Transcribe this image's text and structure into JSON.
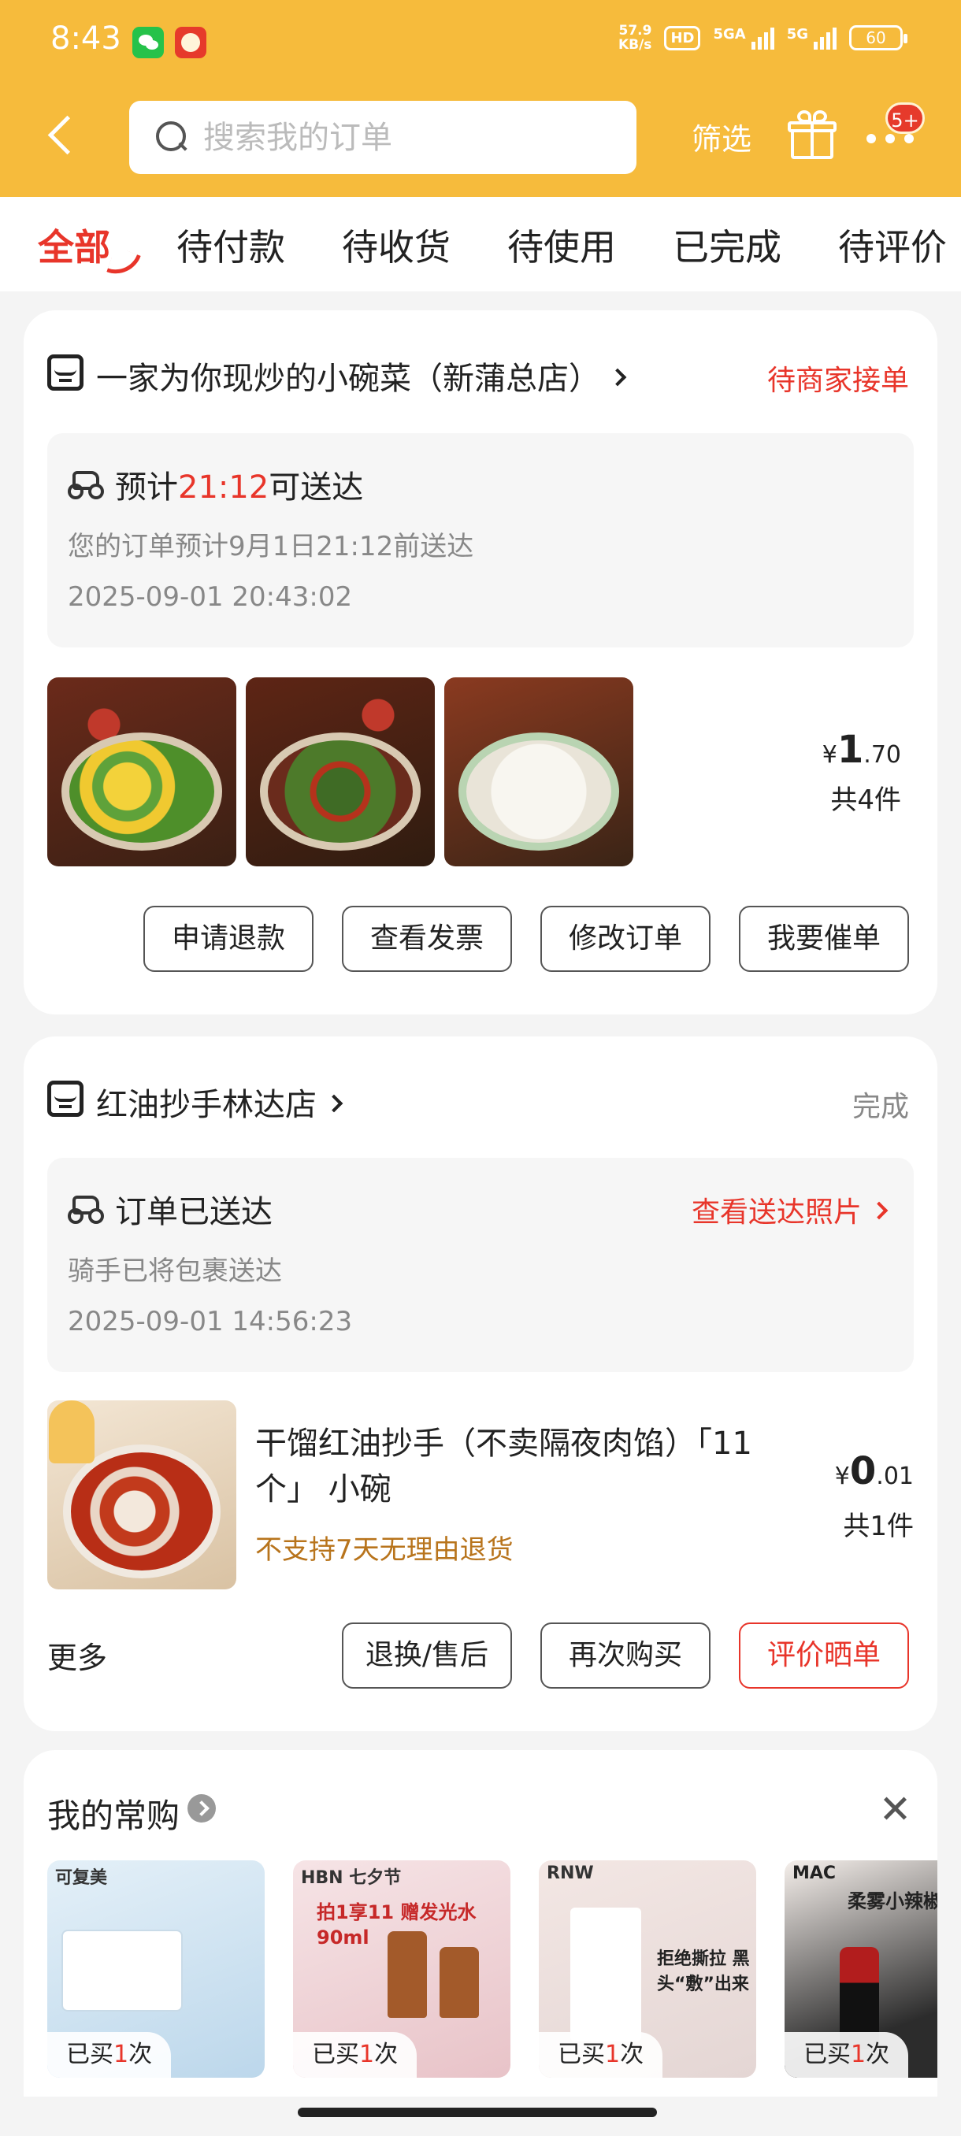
{
  "status_bar": {
    "time": "8:43",
    "net_speed_top": "57.9",
    "net_speed_bottom": "KB/s",
    "hd": "HD",
    "sig1": "5GA",
    "sig2": "5G",
    "battery": "60"
  },
  "header": {
    "search_placeholder": "搜索我的订单",
    "filter_label": "筛选",
    "more_badge": "5+"
  },
  "tabs": [
    "全部",
    "待付款",
    "待收货",
    "待使用",
    "已完成",
    "待评价"
  ],
  "orders": [
    {
      "store": "一家为你现炒的小碗菜（新蒲总店）",
      "status": "待商家接单",
      "delivery_prefix": "预计",
      "delivery_time": "21:12",
      "delivery_suffix": "可送达",
      "note": "您的订单预计9月1日21:12前送达",
      "timestamp": "2025-09-01 20:43:02",
      "price_symbol": "¥",
      "price_int": "1",
      "price_dec": ".70",
      "count": "共4件",
      "buttons": [
        "申请退款",
        "查看发票",
        "修改订单",
        "我要催单"
      ]
    },
    {
      "store": "红油抄手林达店",
      "status": "完成",
      "delivery_text": "订单已送达",
      "photo_link": "查看送达照片",
      "note": "骑手已将包裹送达",
      "timestamp": "2025-09-01 14:56:23",
      "product_title": "干馏红油抄手（不卖隔夜肉馅）「11个」 小碗",
      "return_note": "不支持7天无理由退货",
      "price_symbol": "¥",
      "price_int": "0",
      "price_dec": ".01",
      "count": "共1件",
      "more_label": "更多",
      "buttons": [
        "退换/售后",
        "再次购买",
        "评价晒单"
      ]
    }
  ],
  "frequent": {
    "title": "我的常购",
    "items": [
      {
        "brand": "可复美",
        "bought_prefix": "已买",
        "bought_count": "1",
        "bought_suffix": "次"
      },
      {
        "brand": "HBN 七夕节",
        "headline": "拍1享11 赠发光水90ml",
        "bought_prefix": "已买",
        "bought_count": "1",
        "bought_suffix": "次"
      },
      {
        "brand": "RNW",
        "headline": "拒绝撕拉 黑头“敷”出来",
        "bought_prefix": "已买",
        "bought_count": "1",
        "bought_suffix": "次"
      },
      {
        "brand": "MAC",
        "headline": "柔雾小辣椒",
        "bought_prefix": "已买",
        "bought_count": "1",
        "bought_suffix": "次"
      }
    ]
  },
  "colors": {
    "header_bg": "#f6bb3c",
    "accent_red": "#e8352a",
    "warning_orange": "#b8741c"
  }
}
